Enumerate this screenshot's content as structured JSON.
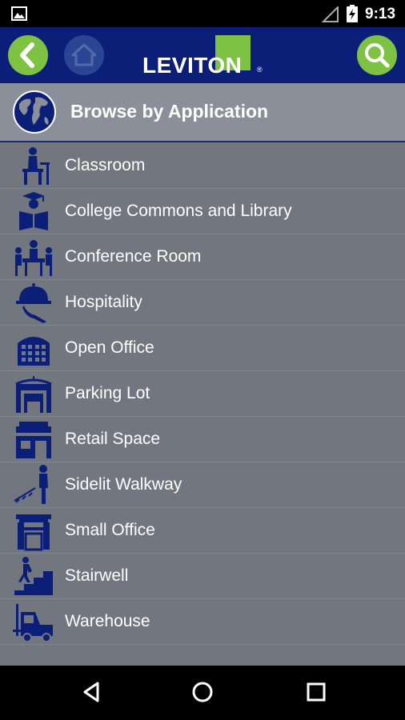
{
  "status_bar": {
    "time": "9:13"
  },
  "header": {
    "logo_text": "LEVITON",
    "logo_mark": "®"
  },
  "section": {
    "title": "Browse by Application"
  },
  "items": [
    {
      "label": "Classroom",
      "icon": "classroom-icon"
    },
    {
      "label": "College Commons and Library",
      "icon": "library-icon"
    },
    {
      "label": "Conference Room",
      "icon": "conference-icon"
    },
    {
      "label": "Hospitality",
      "icon": "hospitality-icon"
    },
    {
      "label": "Open Office",
      "icon": "open-office-icon"
    },
    {
      "label": "Parking Lot",
      "icon": "parking-lot-icon"
    },
    {
      "label": "Retail Space",
      "icon": "retail-icon"
    },
    {
      "label": "Sidelit Walkway",
      "icon": "walkway-icon"
    },
    {
      "label": "Small Office",
      "icon": "small-office-icon"
    },
    {
      "label": "Stairwell",
      "icon": "stairwell-icon"
    },
    {
      "label": "Warehouse",
      "icon": "warehouse-icon"
    }
  ],
  "colors": {
    "header_bg": "#0b1f78",
    "accent_green": "#7dc242",
    "list_bg": "#72767f",
    "icon_blue": "#0b1f78"
  }
}
